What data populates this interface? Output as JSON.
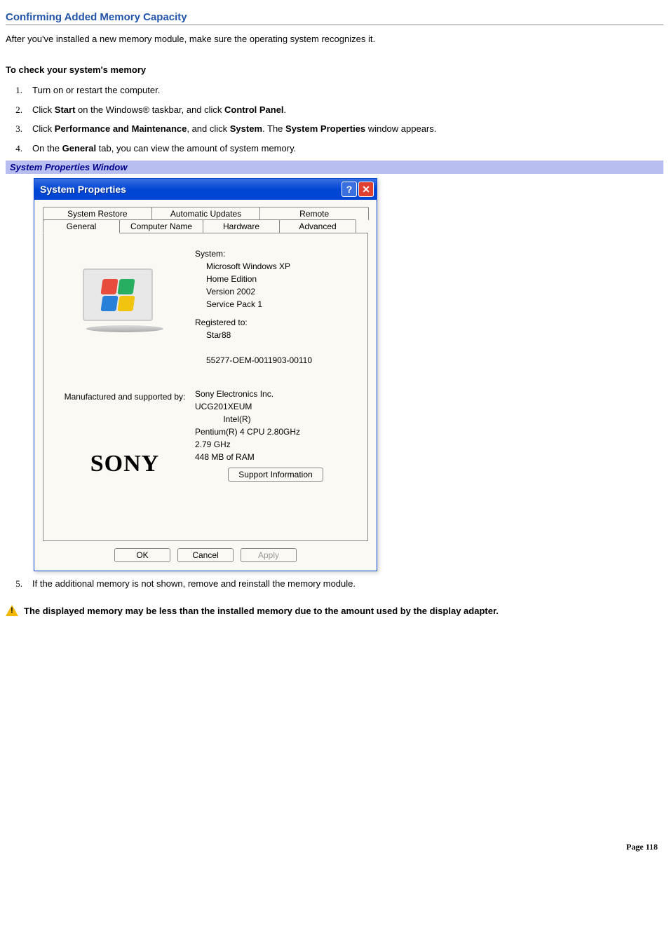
{
  "page": {
    "title": "Confirming Added Memory Capacity",
    "intro": "After you've installed a new memory module, make sure the operating system recognizes it.",
    "subhead": "To check your system's memory",
    "page_number": "Page 118"
  },
  "steps": {
    "s1": {
      "num": "1.",
      "text": "Turn on or restart the computer."
    },
    "s2": {
      "num": "2.",
      "pre": "Click ",
      "b1": "Start",
      "mid": " on the Windows® taskbar, and click ",
      "b2": "Control Panel",
      "post": "."
    },
    "s3": {
      "num": "3.",
      "pre": "Click ",
      "b1": "Performance and Maintenance",
      "mid": ", and click ",
      "b2": "System",
      "mid2": ". The ",
      "b3": "System Properties",
      "post": " window appears."
    },
    "s4": {
      "num": "4.",
      "pre": "On the ",
      "b1": "General",
      "post": " tab, you can view the amount of system memory."
    },
    "s5": {
      "num": "5.",
      "text": "If the additional memory is not shown, remove and reinstall the memory module."
    }
  },
  "caption": "System Properties Window",
  "window": {
    "title": "System Properties",
    "help_glyph": "?",
    "close_glyph": "✕",
    "tabs_back": [
      "System Restore",
      "Automatic Updates",
      "Remote"
    ],
    "tabs_front": [
      "General",
      "Computer Name",
      "Hardware",
      "Advanced"
    ],
    "labels": {
      "system": "System:",
      "registered": "Registered to:",
      "mfr": "Manufactured and supported by:"
    },
    "system_lines": [
      "Microsoft Windows XP",
      "Home Edition",
      "Version 2002",
      "Service Pack 1"
    ],
    "registered_lines": [
      "Star88"
    ],
    "product_id": "55277-OEM-0011903-00110",
    "mfr_lines": [
      "Sony Electronics Inc.",
      "UCG201XEUM",
      "Intel(R)",
      "Pentium(R) 4 CPU 2.80GHz",
      "2.79 GHz",
      "448 MB of RAM"
    ],
    "sony": "SONY",
    "buttons": {
      "support": "Support Information",
      "ok": "OK",
      "cancel": "Cancel",
      "apply": "Apply"
    }
  },
  "note": "The displayed memory may be less than the installed memory due to the amount used by the display adapter."
}
